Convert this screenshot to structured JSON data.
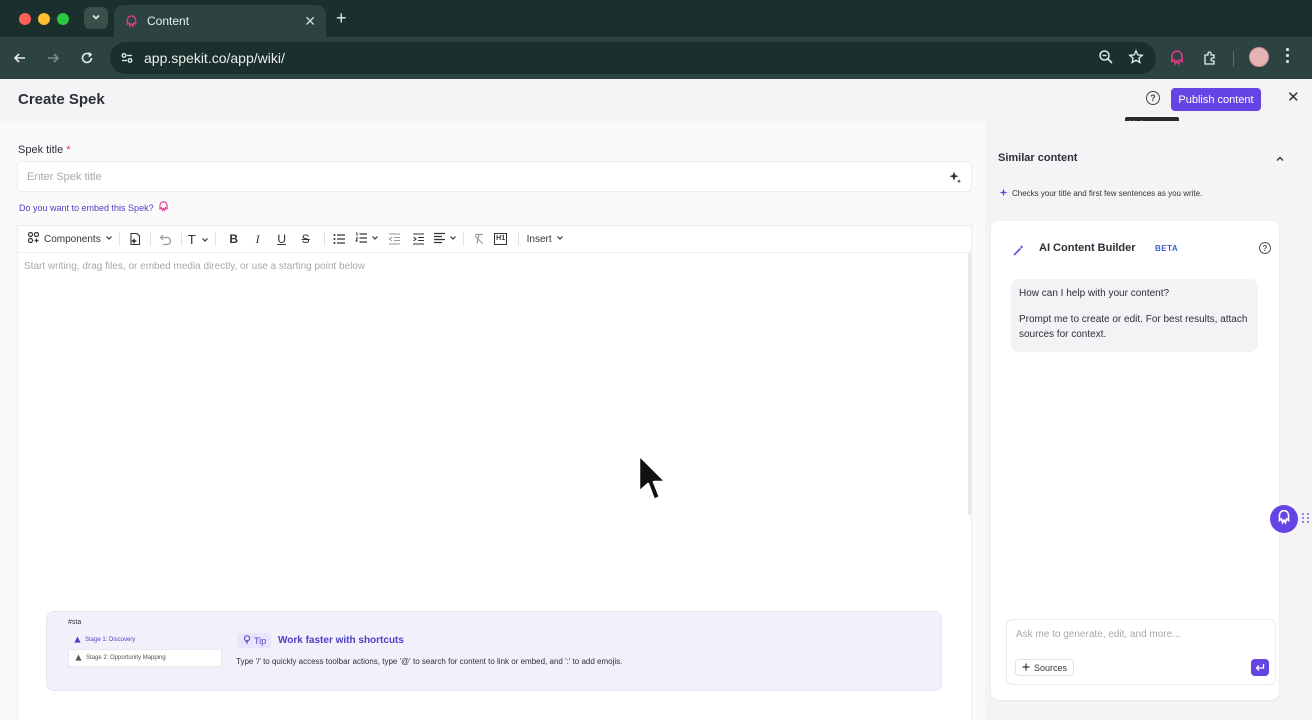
{
  "browser": {
    "tab_title": "Content",
    "url": "app.spekit.co/app/wiki/",
    "new_tab_label": "+",
    "tab_close": "✕"
  },
  "header": {
    "title": "Create Spek",
    "publish_label": "Publish content",
    "help_tooltip": "Help center",
    "help_glyph": "?",
    "close_glyph": "✕"
  },
  "editor": {
    "title_label": "Spek title",
    "required_mark": "*",
    "title_placeholder": "Enter Spek title",
    "title_value": "",
    "embed_prompt": "Do you want to embed this Spek?",
    "toolbar": {
      "components_label": "Components",
      "insert_label": "Insert",
      "heading_glyph": "T",
      "bold_glyph": "B",
      "italic_glyph": "I",
      "underline_glyph": "U",
      "strike_glyph": "S",
      "h1_glyph": "H1"
    },
    "body_placeholder": "Start writing, drag files, or embed media directly, or use a starting point below"
  },
  "tip": {
    "preview_query": "#sta",
    "preview_option_1": "Stage 1: Discovery",
    "preview_option_2": "Stage 2: Opportunity Mapping",
    "badge": "Tip",
    "heading": "Work faster with shortcuts",
    "text": "Type '/' to quickly access toolbar actions, type '@' to search for content to link or embed, and ':' to add emojis."
  },
  "similar": {
    "title": "Similar content",
    "note": "Checks your title and first few sentences as you write."
  },
  "ai_builder": {
    "title": "AI Content Builder",
    "badge": "BETA",
    "help_glyph": "?",
    "message_line_1": "How can I help with your content?",
    "message_line_2": "Prompt me to create or edit. For best results, attach sources for context.",
    "input_placeholder": "Ask me to generate, edit, and more...",
    "sources_label": "Sources"
  },
  "colors": {
    "accent": "#6544e4",
    "link": "#4c3fc7",
    "browser_dark": "#1b2f2c",
    "browser_toolbar": "#2c4340"
  }
}
